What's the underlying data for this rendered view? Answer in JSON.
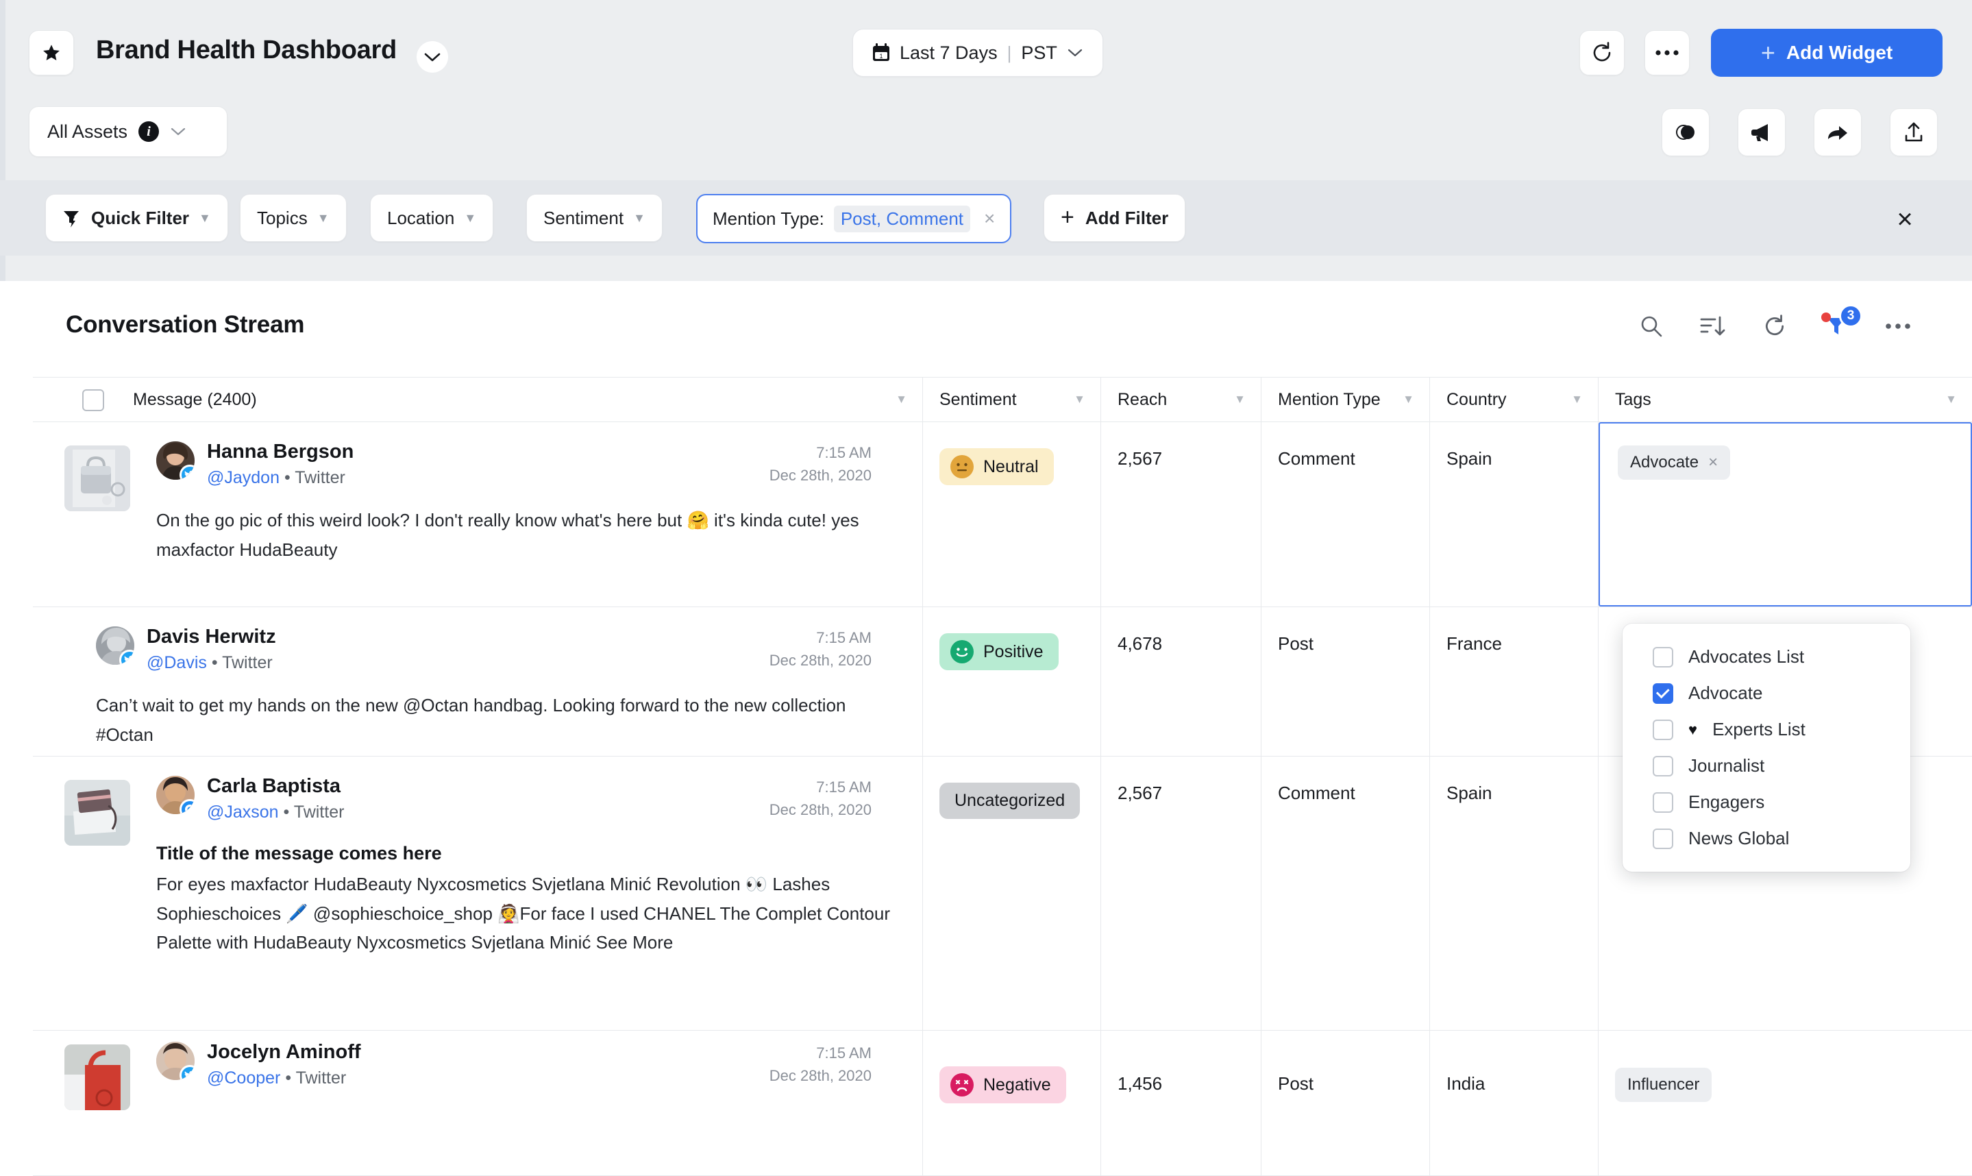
{
  "header": {
    "star_icon": "star-icon",
    "dashboard_title": "Brand Health Dashboard",
    "dashboard_caret": "chevron-down-icon",
    "date_range": {
      "icon": "calendar-icon",
      "label": "Last 7 Days",
      "separator": "|",
      "timezone": "PST",
      "caret": "chevron-down-icon"
    },
    "refresh_label": "refresh-icon",
    "more_label": "more-horizontal-icon",
    "add_widget": {
      "plus": "+",
      "label": "Add Widget"
    },
    "assets": {
      "label": "All Assets",
      "info": "i",
      "caret": "chevron-down-icon"
    },
    "tools": [
      {
        "name": "dark-mode-toggle-icon"
      },
      {
        "name": "megaphone-icon"
      },
      {
        "name": "share-icon"
      },
      {
        "name": "export-icon"
      }
    ]
  },
  "filter_bar": {
    "quick_filter": {
      "label": "Quick Filter",
      "icon": "funnel-bolt-icon"
    },
    "chips": [
      {
        "label": "Topics"
      },
      {
        "label": "Location"
      },
      {
        "label": "Sentiment"
      }
    ],
    "active_filter": {
      "label": "Mention Type:",
      "value": "Post, Comment",
      "remove": "×"
    },
    "add_filter": {
      "plus": "+",
      "label": "Add Filter"
    },
    "close": "×"
  },
  "panel": {
    "title": "Conversation Stream",
    "actions": [
      {
        "name": "search-icon"
      },
      {
        "name": "sort-icon"
      },
      {
        "name": "refresh-icon"
      },
      {
        "name": "filter-icon",
        "badge": "3"
      },
      {
        "name": "more-horizontal-icon"
      }
    ]
  },
  "table": {
    "columns": [
      {
        "key": "message",
        "label": "Message (2400)"
      },
      {
        "key": "sentiment",
        "label": "Sentiment"
      },
      {
        "key": "reach",
        "label": "Reach"
      },
      {
        "key": "mention_type",
        "label": "Mention Type"
      },
      {
        "key": "country",
        "label": "Country"
      },
      {
        "key": "tags",
        "label": "Tags"
      }
    ],
    "rows": [
      {
        "author": "Hanna Bergson",
        "handle": "@Jaydon",
        "network": "Twitter",
        "time": "7:15 AM",
        "date": "Dec 28th, 2020",
        "has_thumb": true,
        "title": "",
        "text": "On the go pic of this weird look? I don't really know what's here but 🤗 it's kinda cute! yes maxfactor HudaBeauty",
        "sentiment": "Neutral",
        "sentiment_color": "#fbeec9",
        "sentiment_emoji_color": "#e2a53b",
        "reach": "2,567",
        "mention_type": "Comment",
        "country": "Spain",
        "tag": "Advocate",
        "tag_editing": true
      },
      {
        "author": "Davis Herwitz",
        "handle": "@Davis",
        "network": "Twitter",
        "time": "7:15 AM",
        "date": "Dec 28th, 2020",
        "has_thumb": false,
        "title": "",
        "text": "Can’t wait to get my hands on the new @Octan handbag. Looking forward to the new collection #Octan",
        "sentiment": "Positive",
        "sentiment_color": "#b7ebd2",
        "sentiment_emoji_color": "#16a971",
        "reach": "4,678",
        "mention_type": "Post",
        "country": "France",
        "tag": "",
        "tag_editing": false
      },
      {
        "author": "Carla Baptista",
        "handle": "@Jaxson",
        "network": "Twitter",
        "time": "7:15 AM",
        "date": "Dec 28th, 2020",
        "has_thumb": true,
        "title": "Title of the message comes here",
        "text": "For eyes maxfactor HudaBeauty Nyxcosmetics Svjetlana Minić Revolution 👀 Lashes Sophieschoices 🖊️ @sophieschoice_shop 👰For face I used CHANEL The Complet Contour Palette with HudaBeauty Nyxcosmetics Svjetlana Minić  See More",
        "sentiment": "Uncategorized",
        "sentiment_color": "#cfd1d4",
        "sentiment_emoji_color": "",
        "reach": "2,567",
        "mention_type": "Comment",
        "country": "Spain",
        "tag": "",
        "tag_editing": false
      },
      {
        "author": "Jocelyn Aminoff",
        "handle": "@Cooper",
        "network": "Twitter",
        "time": "7:15 AM",
        "date": "Dec 28th, 2020",
        "has_thumb": true,
        "title": "",
        "text": "",
        "sentiment": "Negative",
        "sentiment_color": "#fbd4e2",
        "sentiment_emoji_color": "#d81b60",
        "reach": "1,456",
        "mention_type": "Post",
        "country": "India",
        "tag": "Influencer",
        "tag_editing": false
      }
    ]
  },
  "tag_dropdown": {
    "items": [
      {
        "label": "Advocates List",
        "checked": false,
        "icon": ""
      },
      {
        "label": "Advocate",
        "checked": true,
        "icon": ""
      },
      {
        "label": "Experts List",
        "checked": false,
        "icon": "♥"
      },
      {
        "label": "Journalist",
        "checked": false,
        "icon": ""
      },
      {
        "label": "Engagers",
        "checked": false,
        "icon": ""
      },
      {
        "label": "News Global",
        "checked": false,
        "icon": ""
      }
    ]
  },
  "colors": {
    "accent": "#2f6fed",
    "focus": "#4d7fef",
    "chrome": "#eceef0",
    "filterbar": "#e4e7eb"
  }
}
